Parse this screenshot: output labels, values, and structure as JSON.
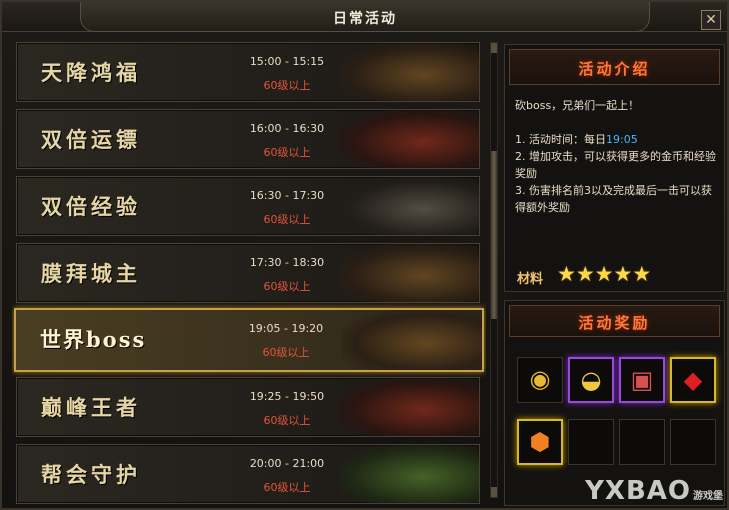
{
  "window": {
    "title": "日常活动",
    "close_symbol": "✕"
  },
  "activities": [
    {
      "name": "天降鸿福",
      "time": "15:00 - 15:15",
      "level": "60级以上",
      "art": "treasure-chest"
    },
    {
      "name": "双倍运镖",
      "time": "16:00 - 16:30",
      "level": "60级以上",
      "art": "cart"
    },
    {
      "name": "双倍经验",
      "time": "16:30 - 17:30",
      "level": "60级以上",
      "art": "exp-cards"
    },
    {
      "name": "膜拜城主",
      "time": "17:30 - 18:30",
      "level": "60级以上",
      "art": "statue"
    },
    {
      "name": "世界boss",
      "time": "19:05 - 19:20",
      "level": "60级以上",
      "art": "boss",
      "selected": true
    },
    {
      "name": "巅峰王者",
      "time": "19:25 - 19:50",
      "level": "60级以上",
      "art": "arena"
    },
    {
      "name": "帮会守护",
      "time": "20:00 - 21:00",
      "level": "60级以上",
      "art": "castle"
    }
  ],
  "intro": {
    "title": "活动介绍",
    "line1": "砍boss，兄弟们一起上！",
    "line2_prefix": "1. 活动时间：每日",
    "line2_time": "19:05",
    "line3": "2. 增加攻击，可以获得更多的金币和经验奖励",
    "line4": "3. 伤害排名前3以及完成最后一击可以获得额外奖励",
    "material_label": "材料",
    "stars": 5
  },
  "rewards": {
    "title": "活动奖励",
    "items": [
      {
        "icon": "gold-coins-icon",
        "glyph": "◉",
        "color": "#e8b830",
        "frame": "none"
      },
      {
        "icon": "gold-ingot-icon",
        "glyph": "◒",
        "color": "#f0c840",
        "frame": "purple"
      },
      {
        "icon": "scroll-icon",
        "glyph": "▣",
        "color": "#d85050",
        "frame": "purple"
      },
      {
        "icon": "red-gem-icon",
        "glyph": "◆",
        "color": "#e02020",
        "frame": "gold"
      },
      {
        "icon": "orange-gem-icon",
        "glyph": "⬢",
        "color": "#f08020",
        "frame": "gold"
      },
      {
        "icon": "empty-slot",
        "glyph": "",
        "color": "#000000",
        "frame": "none"
      },
      {
        "icon": "empty-slot",
        "glyph": "",
        "color": "#000000",
        "frame": "none"
      },
      {
        "icon": "empty-slot",
        "glyph": "",
        "color": "#000000",
        "frame": "none"
      }
    ]
  },
  "watermark": {
    "text": "YXBAO",
    "sub": "游戏堡"
  },
  "colors": {
    "level_red": "#e2553a",
    "highlight_blue": "#4ab4ff",
    "title_orange": "#ff7a3a",
    "selected_gold": "#c9a04a"
  }
}
